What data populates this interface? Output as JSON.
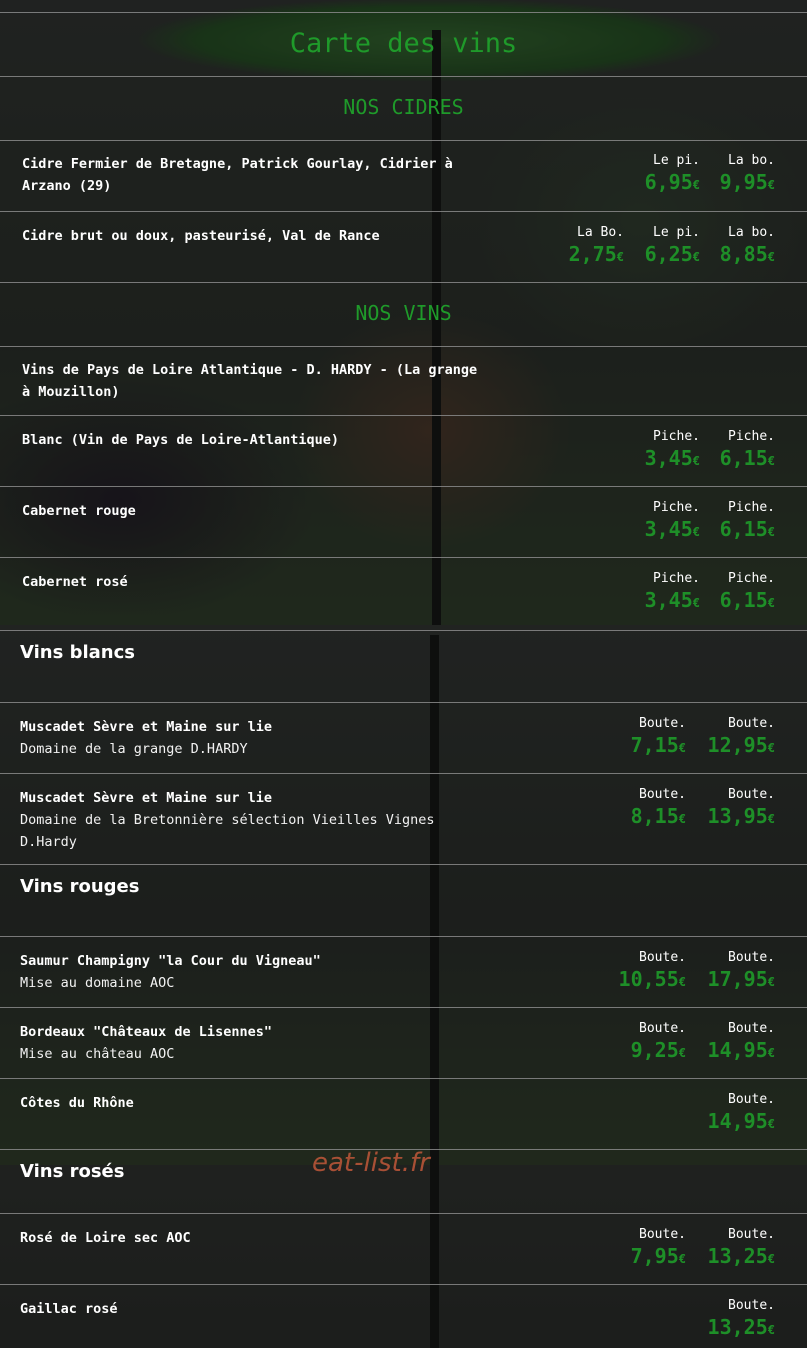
{
  "title": "Carte des vins",
  "watermark": "eat-list.fr",
  "colors": {
    "accent_green": "#1e8f28",
    "text": "#ffffff",
    "watermark": "#c0583a"
  },
  "sections": {
    "cidres": {
      "title": "NOS CIDRES",
      "items": [
        {
          "name_line1": "Cidre Fermier de Bretagne, Patrick Gourlay, Cidrier à",
          "name_line2": "Arzano (29)",
          "prices": [
            {
              "label": "Le pi.",
              "main": "6,95",
              "cur": "€"
            },
            {
              "label": "La bo.",
              "main": "9,95",
              "cur": "€"
            }
          ]
        },
        {
          "name_line1": "Cidre brut ou doux, pasteurisé, Val de Rance",
          "prices": [
            {
              "label": "La Bo.",
              "main": "2,75",
              "cur": "€"
            },
            {
              "label": "Le pi.",
              "main": "6,25",
              "cur": "€"
            },
            {
              "label": "La bo.",
              "main": "8,85",
              "cur": "€"
            }
          ]
        }
      ]
    },
    "vins": {
      "title": "NOS VINS",
      "intro_line1": "Vins de Pays de Loire Atlantique - D. HARDY - (La grange",
      "intro_line2": "à Mouzillon)",
      "items": [
        {
          "name": "Blanc (Vin de Pays de Loire-Atlantique)",
          "prices": [
            {
              "label": "Piche.",
              "main": "3,45",
              "cur": "€"
            },
            {
              "label": "Piche.",
              "main": "6,15",
              "cur": "€"
            }
          ]
        },
        {
          "name": "Cabernet rouge",
          "prices": [
            {
              "label": "Piche.",
              "main": "3,45",
              "cur": "€"
            },
            {
              "label": "Piche.",
              "main": "6,15",
              "cur": "€"
            }
          ]
        },
        {
          "name": "Cabernet rosé",
          "prices": [
            {
              "label": "Piche.",
              "main": "3,45",
              "cur": "€"
            },
            {
              "label": "Piche.",
              "main": "6,15",
              "cur": "€"
            }
          ]
        }
      ]
    },
    "blancs": {
      "title": "Vins blancs",
      "items": [
        {
          "name": "Muscadet Sèvre et Maine sur lie",
          "sub1": "Domaine de la grange D.HARDY",
          "prices": [
            {
              "label": "Boute.",
              "main": "7,15",
              "cur": "€"
            },
            {
              "label": "Boute.",
              "main": "12,95",
              "cur": "€"
            }
          ]
        },
        {
          "name": "Muscadet Sèvre et Maine sur lie",
          "sub1": "Domaine de la Bretonnière sélection Vieilles Vignes",
          "sub2": "D.Hardy",
          "prices": [
            {
              "label": "Boute.",
              "main": "8,15",
              "cur": "€"
            },
            {
              "label": "Boute.",
              "main": "13,95",
              "cur": "€"
            }
          ]
        }
      ]
    },
    "rouges": {
      "title": "Vins rouges",
      "items": [
        {
          "name": "Saumur Champigny \"la Cour du Vigneau\"",
          "sub1": "Mise au domaine AOC",
          "prices": [
            {
              "label": "Boute.",
              "main": "10,55",
              "cur": "€"
            },
            {
              "label": "Boute.",
              "main": "17,95",
              "cur": "€"
            }
          ]
        },
        {
          "name": "Bordeaux \"Châteaux de Lisennes\"",
          "sub1": "Mise au château AOC",
          "prices": [
            {
              "label": "Boute.",
              "main": "9,25",
              "cur": "€"
            },
            {
              "label": "Boute.",
              "main": "14,95",
              "cur": "€"
            }
          ]
        },
        {
          "name": "Côtes du Rhône",
          "prices": [
            {
              "label": "Boute.",
              "main": "14,95",
              "cur": "€"
            }
          ]
        }
      ]
    },
    "roses": {
      "title": "Vins rosés",
      "items": [
        {
          "name": "Rosé de Loire sec AOC",
          "prices": [
            {
              "label": "Boute.",
              "main": "7,95",
              "cur": "€"
            },
            {
              "label": "Boute.",
              "main": "13,25",
              "cur": "€"
            }
          ]
        },
        {
          "name": "Gaillac rosé",
          "prices": [
            {
              "label": "Boute.",
              "main": "13,25",
              "cur": "€"
            }
          ]
        }
      ]
    }
  }
}
